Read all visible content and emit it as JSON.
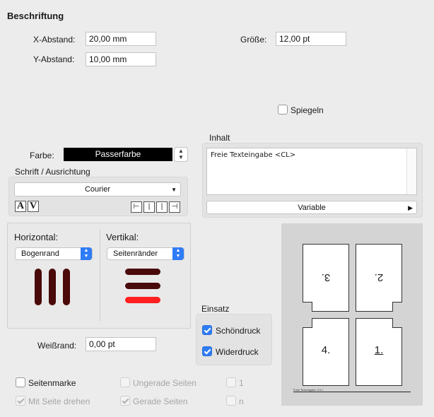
{
  "section_title": "Beschriftung",
  "x_abstand": {
    "label": "X-Abstand:",
    "value": "20,00 mm"
  },
  "y_abstand": {
    "label": "Y-Abstand:",
    "value": "10,00 mm"
  },
  "groesse": {
    "label": "Größe:",
    "value": "12,00 pt"
  },
  "spiegeln": {
    "label": "Spiegeln",
    "checked": false
  },
  "farbe": {
    "label": "Farbe:",
    "value": "Passerfarbe"
  },
  "schrift": {
    "group_label": "Schrift / Ausrichtung",
    "font": "Courier",
    "style_a": "A",
    "style_v": "V"
  },
  "inhalt": {
    "group_label": "Inhalt",
    "text": "Freie Texteingabe <CL>",
    "variable_label": "Variable"
  },
  "horizontal": {
    "label": "Horizontal:",
    "value": "Bogenrand"
  },
  "vertikal": {
    "label": "Vertikal:",
    "value": "Seitenränder"
  },
  "einsatz": {
    "group_label": "Einsatz",
    "schoendruck": {
      "label": "Schöndruck",
      "checked": true
    },
    "widerdruck": {
      "label": "Widerdruck",
      "checked": true
    }
  },
  "weissrand": {
    "label": "Weißrand:",
    "value": "0,00 pt"
  },
  "preview": {
    "pages": [
      "3.",
      "2.",
      "4.",
      "1."
    ],
    "caption": "Freie Texteingabe <CL>"
  },
  "options": {
    "seitenmarke": {
      "label": "Seitenmarke",
      "checked": false
    },
    "mit_seite_drehen": {
      "label": "Mit Seite drehen",
      "checked": true
    },
    "ungerade_seiten": {
      "label": "Ungerade Seiten",
      "checked": false
    },
    "gerade_seiten": {
      "label": "Gerade Seiten",
      "checked": true
    },
    "eins": {
      "label": "1",
      "checked": false
    },
    "n": {
      "label": "n",
      "checked": false
    }
  },
  "colors": {
    "accent": "#2f7cf6",
    "bar_dark": "#4a0a0a",
    "bar_red": "#ff2020"
  }
}
